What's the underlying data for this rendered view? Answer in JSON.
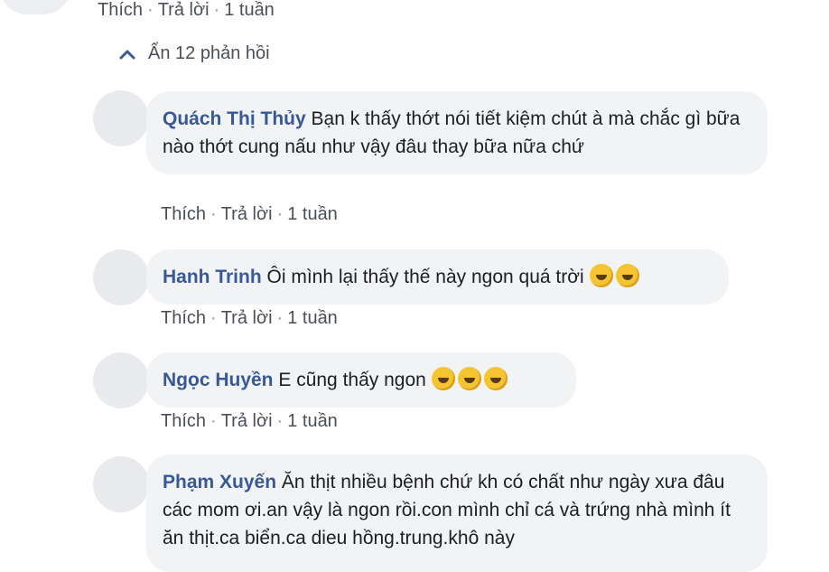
{
  "top_comment": {
    "like": "Thích",
    "reply": "Trả lời",
    "time": "1 tuần"
  },
  "replies_toggle": {
    "label": "Ẩn 12 phản hồi",
    "icon": "chevron-up-icon"
  },
  "replies": [
    {
      "author": "Quách Thị Thủy",
      "text": "Bạn k thấy thớt nói tiết kiệm chút à mà chắc gì bữa nào thớt cung nấu như vậy đâu thay bữa nữa chứ",
      "like": "Thích",
      "reply": "Trả lời",
      "time": "1 tuần"
    },
    {
      "author": "Hanh Trinh",
      "text": "Ôi mình lại thấy thế này ngon quá trời",
      "emojis": [
        "laughing-emoji",
        "laughing-emoji"
      ],
      "like": "Thích",
      "reply": "Trả lời",
      "time": "1 tuần"
    },
    {
      "author": "Ngọc Huyền",
      "text": "E cũng thấy ngon",
      "emojis": [
        "rofl-emoji",
        "rofl-emoji",
        "rofl-emoji"
      ],
      "like": "Thích",
      "reply": "Trả lời",
      "time": "1 tuần"
    },
    {
      "author": "Phạm Xuyến",
      "text": "Ăn thịt nhiều bệnh chứ kh có chất như ngày xưa đâu các mom ơi.an vậy là ngon rồi.con mình chỉ cá và trứng nhà mình ít ăn thịt.ca biển.ca dieu hồng.trung.khô này"
    }
  ],
  "colors": {
    "author_link": "#385898",
    "bubble_bg": "#f2f3f5",
    "meta_text": "#4b4f56"
  }
}
